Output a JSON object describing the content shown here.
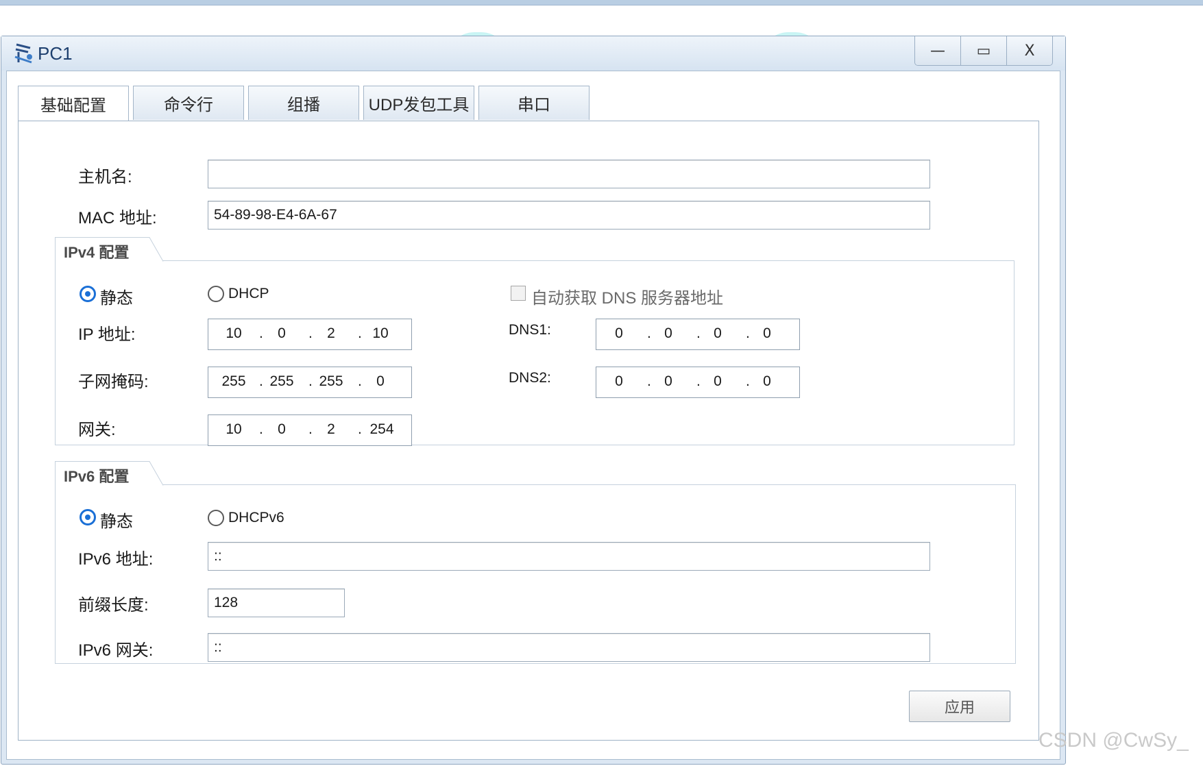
{
  "window": {
    "title": "PC1",
    "minimize_glyph": "—",
    "maximize_glyph": "▭",
    "close_glyph": "X"
  },
  "tabs": [
    {
      "label": "基础配置"
    },
    {
      "label": "命令行"
    },
    {
      "label": "组播"
    },
    {
      "label": "UDP发包工具"
    },
    {
      "label": "串口"
    }
  ],
  "basic": {
    "hostname_label": "主机名:",
    "hostname_value": "",
    "mac_label": "MAC 地址:",
    "mac_value": "54-89-98-E4-6A-67"
  },
  "ipv4": {
    "group_title": "IPv4 配置",
    "static_label": "静态",
    "dhcp_label": "DHCP",
    "auto_dns_label": "自动获取 DNS 服务器地址",
    "ip_label": "IP 地址:",
    "ip": [
      "10",
      "0",
      "2",
      "10"
    ],
    "mask_label": "子网掩码:",
    "mask": [
      "255",
      "255",
      "255",
      "0"
    ],
    "gateway_label": "网关:",
    "gateway": [
      "10",
      "0",
      "2",
      "254"
    ],
    "dns1_label": "DNS1:",
    "dns1": [
      "0",
      "0",
      "0",
      "0"
    ],
    "dns2_label": "DNS2:",
    "dns2": [
      "0",
      "0",
      "0",
      "0"
    ]
  },
  "ipv6": {
    "group_title": "IPv6 配置",
    "static_label": "静态",
    "dhcp_label": "DHCPv6",
    "addr_label": "IPv6 地址:",
    "addr_value": "::",
    "prefix_label": "前缀长度:",
    "prefix_value": "128",
    "gateway_label": "IPv6 网关:",
    "gateway_value": "::"
  },
  "apply_label": "应用",
  "watermark": "CSDN @CwSy_",
  "colors": {
    "accent": "#1a6fd6",
    "title_text": "#1d3f6e",
    "frame": "#dce7f3"
  },
  "icons": {
    "app": "network-pc-icon"
  }
}
